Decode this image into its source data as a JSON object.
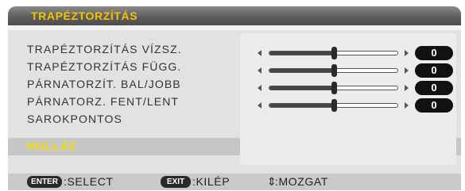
{
  "window": {
    "title": "TRAPÉZTORZÍTÁS"
  },
  "menu": {
    "items": [
      {
        "label": "TRAPÉZTORZÍTÁS VÍZSZ.",
        "value": "0",
        "slider_position": 0.5
      },
      {
        "label": "TRAPÉZTORZÍTÁS FÜGG.",
        "value": "0",
        "slider_position": 0.5
      },
      {
        "label": "PÁRNATORZÍT. BAL/JOBB",
        "value": "0",
        "slider_position": 0.5
      },
      {
        "label": "PÁRNATORZ. FENT/LENT",
        "value": "0",
        "slider_position": 0.5
      },
      {
        "label": "SAROKPONTOS"
      },
      {
        "label": "NULLÁZ",
        "selected": true
      }
    ]
  },
  "footer": {
    "enter_key": "ENTER",
    "enter_hint": ":SELECT",
    "exit_key": "EXIT",
    "exit_hint": ":KILÉP",
    "move_icon": "updown-arrows-icon",
    "move_hint": ":MOZGAT"
  },
  "colors": {
    "title_text": "#f5c400",
    "selected_text": "#f5dc00",
    "panel_bg": "#e2e2e2",
    "value_pill": "#111111"
  }
}
